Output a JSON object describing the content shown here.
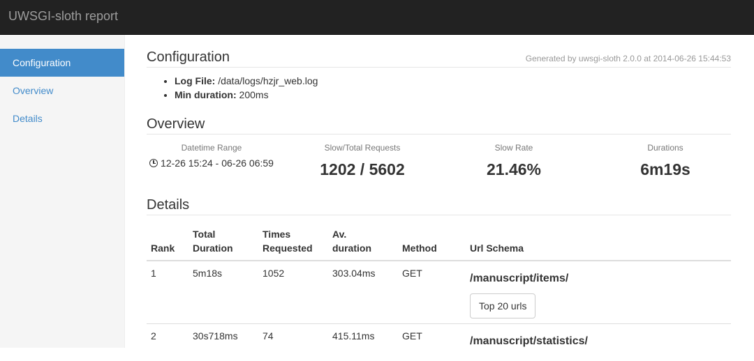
{
  "app": {
    "title": "UWSGI-sloth report"
  },
  "sidebar": {
    "items": [
      {
        "label": "Configuration",
        "active": true
      },
      {
        "label": "Overview"
      },
      {
        "label": "Details"
      }
    ]
  },
  "configuration": {
    "heading": "Configuration",
    "generated": "Generated by uwsgi-sloth 2.0.0 at 2014-06-26 15:44:53",
    "log_file_label": "Log File:",
    "log_file_value": "/data/logs/hzjr_web.log",
    "min_duration_label": "Min duration:",
    "min_duration_value": "200ms"
  },
  "overview": {
    "heading": "Overview",
    "datetime_label": "Datetime Range",
    "datetime_value": "12-26 15:24 - 06-26 06:59",
    "requests_label": "Slow/Total Requests",
    "requests_value": "1202 / 5602",
    "rate_label": "Slow Rate",
    "rate_value": "21.46%",
    "durations_label": "Durations",
    "durations_value": "6m19s"
  },
  "details": {
    "heading": "Details",
    "columns": {
      "rank": "Rank",
      "total_1": "Total",
      "total_2": "Duration",
      "times_1": "Times",
      "times_2": "Requested",
      "av_1": "Av.",
      "av_2": "duration",
      "method": "Method",
      "url": "Url Schema"
    },
    "rows": [
      {
        "rank": "1",
        "total": "5m18s",
        "times": "1052",
        "avg": "303.04ms",
        "method": "GET",
        "url": "/manuscript/items/",
        "button": "Top 20 urls"
      },
      {
        "rank": "2",
        "total": "30s718ms",
        "times": "74",
        "avg": "415.11ms",
        "method": "GET",
        "url": "/manuscript/statistics/"
      }
    ]
  },
  "colors": {
    "accent": "#428bca",
    "topbar": "#222222"
  }
}
